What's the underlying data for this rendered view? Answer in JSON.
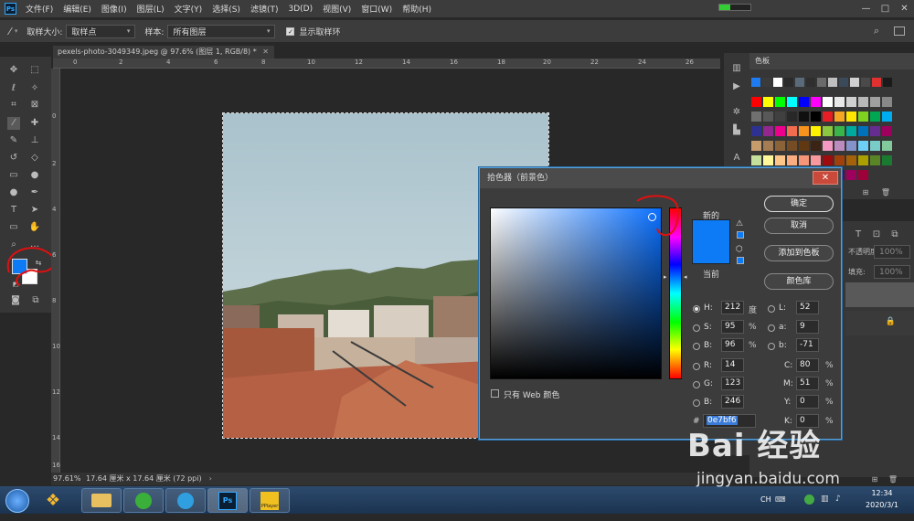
{
  "menubar": {
    "logo": "Ps",
    "items": [
      "文件(F)",
      "编辑(E)",
      "图像(I)",
      "图层(L)",
      "文字(Y)",
      "选择(S)",
      "滤镜(T)",
      "3D(D)",
      "视图(V)",
      "窗口(W)",
      "帮助(H)"
    ],
    "window_controls": [
      "—",
      "□",
      "✕"
    ]
  },
  "options_bar": {
    "tool_icon": "eyedropper-icon",
    "sample_size_label": "取样大小:",
    "sample_size_value": "取样点",
    "sample_label": "样本:",
    "sample_value": "所有图层",
    "show_ring_label": "显示取样环",
    "show_ring_checked": true
  },
  "document": {
    "tab_title": "pexels-photo-3049349.jpeg @ 97.6% (图层 1, RGB/8) *",
    "zoom": "97.61%",
    "doc_info": "17.64 厘米 x 17.64 厘米 (72 ppi)",
    "ruler_top": [
      "0",
      "2",
      "4",
      "6",
      "8",
      "10",
      "12",
      "14",
      "16",
      "18",
      "20",
      "22",
      "24",
      "26"
    ],
    "ruler_left": [
      "0",
      "2",
      "4",
      "6",
      "8",
      "10",
      "12",
      "14",
      "16"
    ]
  },
  "toolbar": {
    "foreground_color": "#0e7bf6",
    "background_color": "#ffffff"
  },
  "panels": {
    "swatches_title": "色板",
    "opacity_label": "不透明度:",
    "opacity_value": "100%",
    "fill_label": "填充:",
    "fill_value": "100%"
  },
  "color_picker": {
    "title": "拾色器（前景色）",
    "new_label": "新的",
    "current_label": "当前",
    "new_color": "#0e7bf6",
    "current_color": "#0e7bf6",
    "hue_color": "#0a70ff",
    "buttons": {
      "ok": "确定",
      "cancel": "取消",
      "add_swatch": "添加到色板",
      "libraries": "颜色库"
    },
    "web_only_label": "只有 Web 颜色",
    "hsb": {
      "h_label": "H:",
      "h": "212",
      "h_unit": "度",
      "s_label": "S:",
      "s": "95",
      "s_unit": "%",
      "b_label": "B:",
      "b": "96",
      "b_unit": "%"
    },
    "rgb": {
      "r_label": "R:",
      "r": "14",
      "g_label": "G:",
      "g": "123",
      "b_label": "B:",
      "b": "246"
    },
    "lab": {
      "l_label": "L:",
      "l": "52",
      "a_label": "a:",
      "a": "9",
      "b_label": "b:",
      "b": "-71"
    },
    "cmyk": {
      "c_label": "C:",
      "c": "80",
      "m_label": "M:",
      "m": "51",
      "y_label": "Y:",
      "y": "0",
      "k_label": "K:",
      "k": "0",
      "unit": "%"
    },
    "hex_label": "#",
    "hex": "0e7bf6"
  },
  "taskbar": {
    "time": "12:34",
    "date": "2020/3/1",
    "lang": "CH",
    "pplayer_label": "PPlayer",
    "ps_label": "Ps"
  },
  "watermark": {
    "brand": "Bai 经验",
    "url": "jingyan.baidu.com"
  }
}
